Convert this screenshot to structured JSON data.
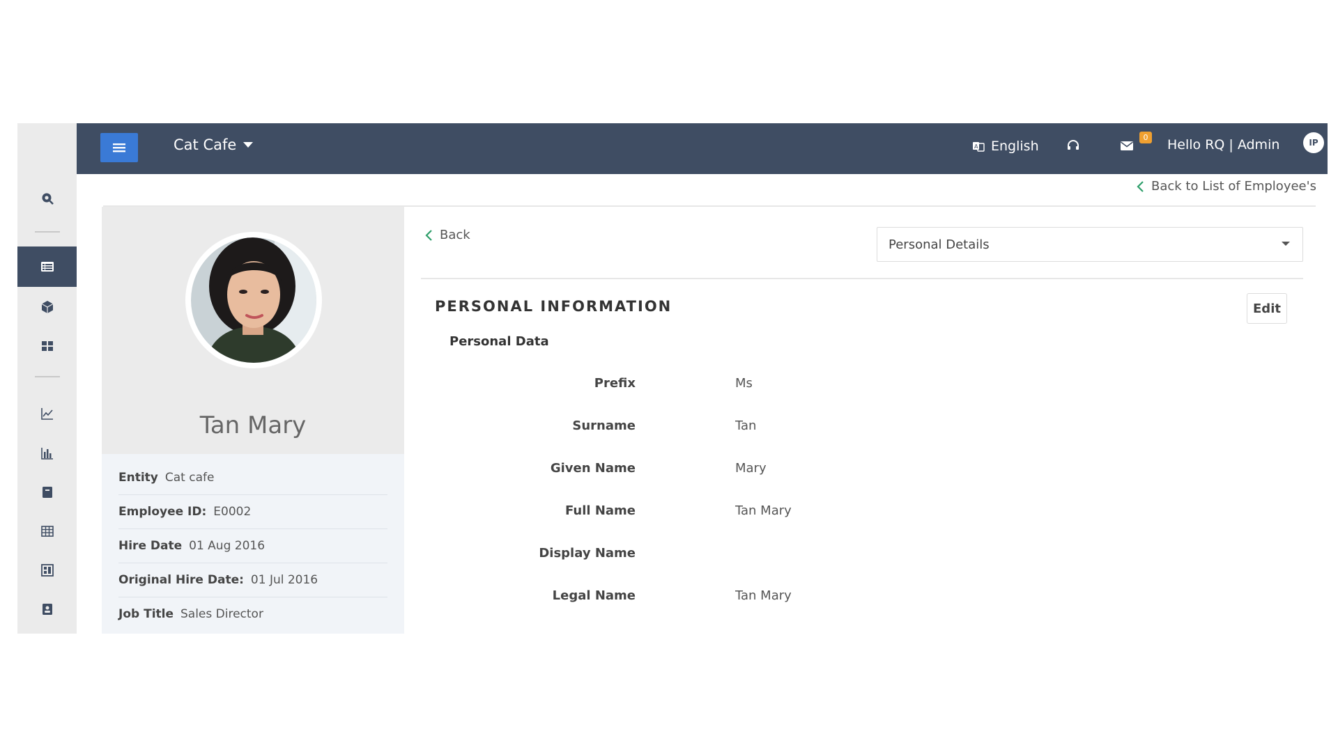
{
  "topbar": {
    "company": "Cat Cafe",
    "language": "English",
    "mail_count": "0",
    "greeting": "Hello RQ | Admin",
    "avatar_initials": "IP"
  },
  "sidebar": {
    "icons": [
      "search-icon",
      "list-icon",
      "cube-icon",
      "grid-icon",
      "line-chart-icon",
      "bar-chart-icon",
      "book-icon",
      "table-icon",
      "dashboard-icon",
      "contact-book-icon"
    ],
    "active": "list-icon"
  },
  "nav": {
    "back_to_list": "Back to List of Employee's",
    "back": "Back"
  },
  "profile": {
    "name": "Tan Mary",
    "rows": [
      {
        "label": "Entity",
        "value": "Cat cafe"
      },
      {
        "label": "Employee ID:",
        "value": "E0002"
      },
      {
        "label": "Hire Date",
        "value": "01 Aug 2016"
      },
      {
        "label": "Original Hire Date:",
        "value": "01 Jul 2016"
      },
      {
        "label": "Job Title",
        "value": "Sales Director"
      }
    ]
  },
  "details": {
    "section_select": "Personal Details",
    "section_title": "PERSONAL INFORMATION",
    "edit_label": "Edit",
    "subsection_title": "Personal Data",
    "fields": [
      {
        "label": "Prefix",
        "value": "Ms"
      },
      {
        "label": "Surname",
        "value": "Tan"
      },
      {
        "label": "Given Name",
        "value": "Mary"
      },
      {
        "label": "Full Name",
        "value": "Tan Mary"
      },
      {
        "label": "Display Name",
        "value": ""
      },
      {
        "label": "Legal Name",
        "value": "Tan Mary"
      }
    ]
  },
  "colors": {
    "topbar": "#3f4d63",
    "menu_button": "#3a7ad6",
    "badge": "#f0a030",
    "back_chevron": "#2e9e6a"
  }
}
